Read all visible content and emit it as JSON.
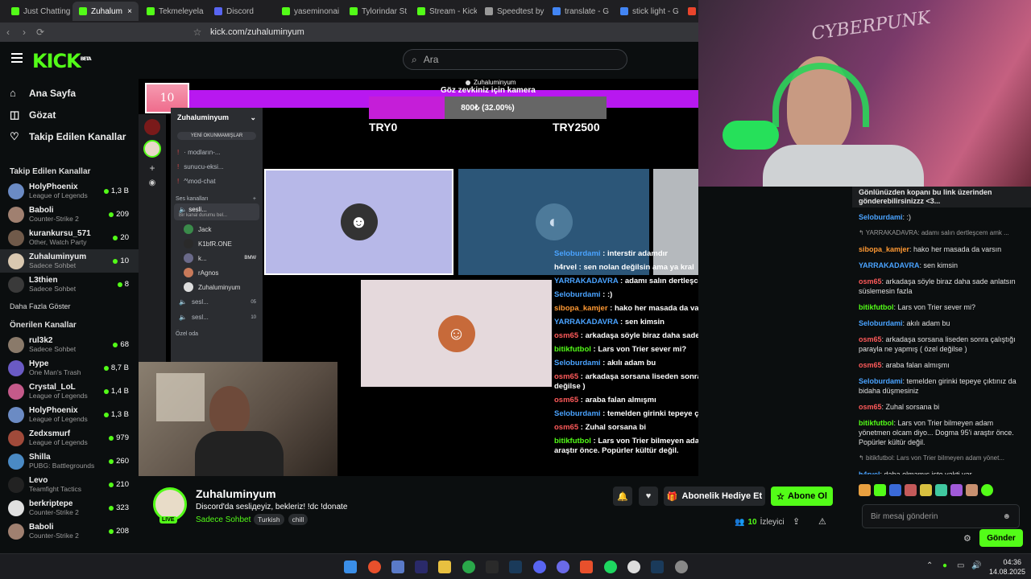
{
  "browser": {
    "tabs": [
      {
        "label": "Just Chatting",
        "color": "#53fc18",
        "active": false
      },
      {
        "label": "Zuhalum",
        "color": "#53fc18",
        "active": true
      },
      {
        "label": "Tekmeleyela",
        "color": "#53fc18",
        "active": false
      },
      {
        "label": "Discord",
        "color": "#5865f2",
        "active": false
      },
      {
        "label": "yaseminonai",
        "color": "#53fc18",
        "active": false
      },
      {
        "label": "Tylorindar St",
        "color": "#53fc18",
        "active": false
      },
      {
        "label": "Stream - Kick",
        "color": "#53fc18",
        "active": false
      },
      {
        "label": "Speedtest by",
        "color": "#999999",
        "active": false
      },
      {
        "label": "translate - G",
        "color": "#4285f4",
        "active": false
      },
      {
        "label": "stick light - G",
        "color": "#4285f4",
        "active": false
      },
      {
        "label": "nd8 16",
        "color": "#e8452c",
        "active": false
      }
    ],
    "url": "kick.com/zuhaluminyum"
  },
  "header": {
    "logo": "KICK",
    "logo_badge": "BETA",
    "search_placeholder": "Ara"
  },
  "sidebar": {
    "nav": [
      {
        "label": "Ana Sayfa",
        "icon": "home-icon"
      },
      {
        "label": "Gözat",
        "icon": "browse-icon"
      },
      {
        "label": "Takip Edilen Kanallar",
        "icon": "heart-icon"
      }
    ],
    "followed_title": "Takip Edilen Kanallar",
    "followed": [
      {
        "name": "HolyPhoenix",
        "category": "League of Legends",
        "viewers": "1,3 B",
        "color": "#6b8bc4"
      },
      {
        "name": "Baboli",
        "category": "Counter-Strike 2",
        "viewers": "209",
        "color": "#a08070"
      },
      {
        "name": "kurankursu_571",
        "category": "Other, Watch Party",
        "viewers": "20",
        "color": "#705a4a"
      },
      {
        "name": "Zuhaluminyum",
        "category": "Sadece Sohbet",
        "viewers": "10",
        "color": "#d9c8b0"
      },
      {
        "name": "L3thien",
        "category": "Sadece Sohbet",
        "viewers": "8",
        "color": "#3a3a3a"
      }
    ],
    "show_more": "Daha Fazla Göster",
    "recommended_title": "Önerilen Kanallar",
    "recommended": [
      {
        "name": "rul3k2",
        "category": "Sadece Sohbet",
        "viewers": "68",
        "color": "#8a7a6a"
      },
      {
        "name": "Hype",
        "category": "One Man's Trash",
        "viewers": "8,7 B",
        "color": "#6a5ac4"
      },
      {
        "name": "Crystal_LoL",
        "category": "League of Legends",
        "viewers": "1,4 B",
        "color": "#c45a8a"
      },
      {
        "name": "HolyPhoenix",
        "category": "League of Legends",
        "viewers": "1,3 B",
        "color": "#6b8bc4"
      },
      {
        "name": "Zedxsmurf",
        "category": "League of Legends",
        "viewers": "979",
        "color": "#a04a3a"
      },
      {
        "name": "Shilla",
        "category": "PUBG: Battlegrounds",
        "viewers": "260",
        "color": "#4a8ac4"
      },
      {
        "name": "Levo",
        "category": "Teamfight Tactics",
        "viewers": "210",
        "color": "#222222"
      },
      {
        "name": "berkriptepe",
        "category": "Counter-Strike 2",
        "viewers": "323",
        "color": "#e0e0e0"
      },
      {
        "name": "Baboli",
        "category": "Counter-Strike 2",
        "viewers": "208",
        "color": "#a08070"
      }
    ]
  },
  "video": {
    "goal_user": "Zuhaluminyum",
    "goal_title": "Göz zevkiniz için kamera",
    "goal_amount": "800₺ (32.00%)",
    "goal_progress": 0.32,
    "goal_min": "TRY0",
    "goal_max": "TRY2500",
    "counter_badge": "10",
    "discord": {
      "server": "Zuhaluminyum",
      "unread": "YENİ OKUNMAMIŞLAR",
      "channels": [
        "· modların-...",
        "sunucu-eksi...",
        "^\\mod-chat"
      ],
      "voice_header": "Ses kanalları",
      "voice_channel": "sesli...",
      "voice_status": "Bir kanal durumu bel...",
      "members": [
        "Jack",
        "K1bfR.ONE",
        "k...",
        "rAgnos",
        "Zuhaluminyum"
      ],
      "member_tag": "BMW",
      "other_voice": [
        {
          "label": "sesl...",
          "count": "05"
        },
        {
          "label": "sesl...",
          "count": "10"
        }
      ],
      "private": "Özel oda"
    },
    "overlay_chat": [
      {
        "user": "Seloburdami",
        "text": "interstir adamdır",
        "color": "#4aa3ff"
      },
      {
        "user": "h4rvel",
        "text": "sen nolan değilsin ama ya kral",
        "color": "#ffffff"
      },
      {
        "user": "YARRAKADAVRA",
        "text": "adamı salın dertleşcem amk",
        "color": "#4aa3ff"
      },
      {
        "user": "Seloburdami",
        "text": ":)",
        "color": "#4aa3ff"
      },
      {
        "user": "sibopa_kamjer",
        "text": "hako her masada da varsın",
        "color": "#ff9933"
      },
      {
        "user": "YARRAKADAVRA",
        "text": "sen kimsin",
        "color": "#4aa3ff"
      },
      {
        "user": "osm65",
        "text": "arkadaşa söyle biraz daha sade anlatsın süslemesin fazla",
        "color": "#ff5a5a"
      },
      {
        "user": "bitikfutbol",
        "text": "Lars von Trier sever mi?",
        "color": "#53fc18"
      },
      {
        "user": "Seloburdami",
        "text": "akılı adam bu",
        "color": "#4aa3ff"
      },
      {
        "user": "osm65",
        "text": "arkadaşa sorsana liseden sonra çalıştığı parayla ne yapmış ( özel değilse )",
        "color": "#ff5a5a"
      },
      {
        "user": "osm65",
        "text": "araba falan almışmı",
        "color": "#ff5a5a"
      },
      {
        "user": "Seloburdami",
        "text": "temelden girinki tepeye çıktınız da bidaha düşmesiniz",
        "color": "#4aa3ff"
      },
      {
        "user": "osm65",
        "text": "Zuhal sorsana bi",
        "color": "#ff5a5a"
      },
      {
        "user": "bitikfutbol",
        "text": "Lars von Trier bilmeyen adam yönetmen olcam diyo... Dogma 95'i araştır önce. Popürler kültür değil.",
        "color": "#53fc18"
      }
    ]
  },
  "stream_info": {
    "channel": "Zuhaluminyum",
    "title": "Discord'da sesliдeyiz, bekleriz! !dc !donate",
    "category": "Sadece Sohbet",
    "tags": [
      "Turkish",
      "chill"
    ],
    "live_badge": "LIVE",
    "gift_button": "Abonelik Hediye Et",
    "subscribe_button": "Abone Ol",
    "viewers": "10",
    "viewers_label": "İzleyici"
  },
  "chat": {
    "pinned": "Gönlünüzden kopanı bu link üzerinden gönderebilirsinizzz <3...",
    "messages": [
      {
        "user": "Seloburdami",
        "text": ":)",
        "color": "#4aa3ff"
      },
      {
        "reply": "YARRAKADAVRA: adamı salın dertleşcem amk ..."
      },
      {
        "user": "sibopa_kamjer",
        "text": "hako her masada da varsın",
        "color": "#ff9933"
      },
      {
        "user": "YARRAKADAVRA",
        "text": "sen kimsin",
        "color": "#4aa3ff"
      },
      {
        "user": "osm65",
        "text": "arkadaşa söyle biraz daha sade anlatsın süslemesin fazla",
        "color": "#ff5a5a"
      },
      {
        "user": "bitikfutbol",
        "text": "Lars von Trier sever mi?",
        "color": "#53fc18"
      },
      {
        "user": "Seloburdami",
        "text": "akılı adam bu",
        "color": "#4aa3ff"
      },
      {
        "user": "osm65",
        "text": "arkadaşa sorsana liseden sonra çalıştığı parayla ne yapmış ( özel değilse )",
        "color": "#ff5a5a"
      },
      {
        "user": "osm65",
        "text": "araba falan almışmı",
        "color": "#ff5a5a"
      },
      {
        "user": "Seloburdami",
        "text": "temelden girinki tepeye çıktınız da bidaha düşmesiniz",
        "color": "#4aa3ff"
      },
      {
        "user": "osm65",
        "text": "Zuhal sorsana bi",
        "color": "#ff5a5a"
      },
      {
        "user": "bitikfutbol",
        "text": "Lars von Trier bilmeyen adam yönetmen olcam diyo... Dogma 95'i araştır önce. Popürler kültür değil.",
        "color": "#53fc18"
      },
      {
        "reply": "bitikfutbol: Lars von Trier bilmeyen adam yönet..."
      },
      {
        "user": "h4rvel",
        "text": "daha olmamış işte vakti var",
        "color": "#4aa3ff"
      }
    ],
    "input_placeholder": "Bir mesaj gönderin",
    "send_button": "Gönder"
  },
  "webcam_text": "CYBERPUNK",
  "taskbar": {
    "time": "04:36",
    "date": "14.08.2025"
  }
}
